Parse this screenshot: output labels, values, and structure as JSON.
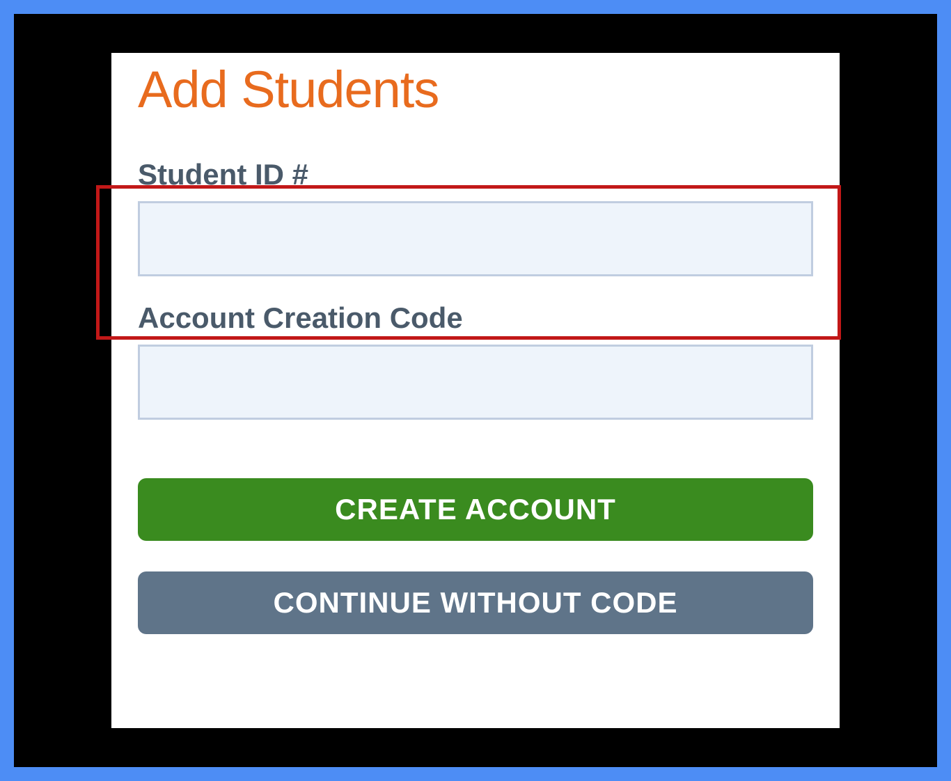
{
  "title": "Add Students",
  "fields": {
    "studentId": {
      "label": "Student ID #",
      "value": ""
    },
    "accountCode": {
      "label": "Account Creation Code",
      "value": ""
    }
  },
  "buttons": {
    "create": "CREATE ACCOUNT",
    "continue": "CONTINUE WITHOUT CODE"
  }
}
